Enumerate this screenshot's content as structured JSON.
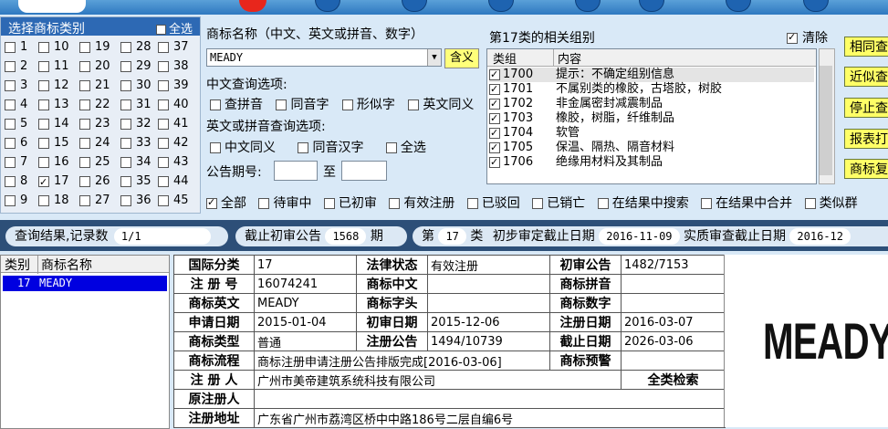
{
  "category_panel": {
    "title": "选择商标类别",
    "select_all": "全选",
    "rows": [
      [
        "1",
        "10",
        "19",
        "28",
        "37"
      ],
      [
        "2",
        "11",
        "20",
        "29",
        "38"
      ],
      [
        "3",
        "12",
        "21",
        "30",
        "39"
      ],
      [
        "4",
        "13",
        "22",
        "31",
        "40"
      ],
      [
        "5",
        "14",
        "23",
        "32",
        "41"
      ],
      [
        "6",
        "15",
        "24",
        "33",
        "42"
      ],
      [
        "7",
        "16",
        "25",
        "34",
        "43"
      ],
      [
        "8",
        "17",
        "26",
        "35",
        "44"
      ],
      [
        "9",
        "18",
        "27",
        "36",
        "45"
      ]
    ],
    "checked": [
      "17"
    ]
  },
  "search": {
    "name_label": "商标名称（中文、英文或拼音、数字）",
    "name_value": "MEADY",
    "confirm_button": "含义",
    "cn_options_label": "中文查询选项:",
    "cn_options": [
      "查拼音",
      "同音字",
      "形似字",
      "英文同义"
    ],
    "en_options_label": "英文或拼音查询选项:",
    "en_options": [
      "中文同义",
      "同音汉字",
      "全选"
    ],
    "period_label": "公告期号:",
    "period_to": "至",
    "period_from_value": "",
    "period_to_value": ""
  },
  "groups": {
    "title": "第17类的相关组别",
    "clear_label": "清除",
    "col_group": "类组",
    "col_content": "内容",
    "rows": [
      {
        "code": "1700",
        "content": "提示：不确定组别信息"
      },
      {
        "code": "1701",
        "content": "不属别类的橡胶，古塔胶，树胶"
      },
      {
        "code": "1702",
        "content": "非金属密封减震制品"
      },
      {
        "code": "1703",
        "content": "橡胶，树脂，纤维制品"
      },
      {
        "code": "1704",
        "content": "软管"
      },
      {
        "code": "1705",
        "content": "保温、隔热、隔音材料"
      },
      {
        "code": "1706",
        "content": "绝缘用材料及其制品"
      }
    ]
  },
  "right_buttons": [
    "相同查",
    "近似查",
    "停止查",
    "报表打",
    "商标复"
  ],
  "filters": [
    "全部",
    "待审中",
    "已初审",
    "有效注册",
    "已驳回",
    "已销亡",
    "在结果中搜索",
    "在结果中合并",
    "类似群"
  ],
  "status": {
    "result_label": "查询结果,记录数",
    "result_value": "1/1",
    "cutoff_label": "截止初审公告",
    "cutoff_value": "1568",
    "cutoff_unit": "期",
    "class_prefix": "第",
    "class_value": "17",
    "class_suffix": "类",
    "prelim_label": "初步审定截止日期",
    "prelim_value": "2016-11-09",
    "subst_label": "实质审查截止日期",
    "subst_value": "2016-12"
  },
  "results": {
    "col_class": "类别",
    "col_name": "商标名称",
    "rows": [
      {
        "class": "17",
        "name": "MEADY"
      }
    ]
  },
  "detail": {
    "intl_class_label": "国际分类",
    "intl_class": "17",
    "legal_status_label": "法律状态",
    "legal_status": "有效注册",
    "prelim_notice_label": "初审公告",
    "prelim_notice": "1482/7153",
    "reg_no_label": "注 册 号",
    "reg_no": "16074241",
    "cn_name_label": "商标中文",
    "cn_name": "",
    "pinyin_label": "商标拼音",
    "pinyin": "",
    "en_name_label": "商标英文",
    "en_name": "MEADY",
    "initials_label": "商标字头",
    "initials": "",
    "digits_label": "商标数字",
    "digits": "",
    "app_date_label": "申请日期",
    "app_date": "2015-01-04",
    "prelim_date_label": "初审日期",
    "prelim_date": "2015-12-06",
    "reg_date_label": "注册日期",
    "reg_date": "2016-03-07",
    "type_label": "商标类型",
    "type": "普通",
    "reg_notice_label": "注册公告",
    "reg_notice": "1494/10739",
    "expiry_label": "截止日期",
    "expiry": "2026-03-06",
    "process_label": "商标流程",
    "process": "商标注册申请注册公告排版完成[2016-03-06]",
    "warning_label": "商标预警",
    "warning": "",
    "registrant_label": "注 册 人",
    "registrant": "广州市美帝建筑系统科技有限公司",
    "full_search": "全类检索",
    "orig_registrant_label": "原注册人",
    "orig_registrant": "",
    "address_label": "注册地址",
    "address": "广东省广州市荔湾区桥中中路186号二层自编6号"
  },
  "mark_image_text": "MEADY"
}
